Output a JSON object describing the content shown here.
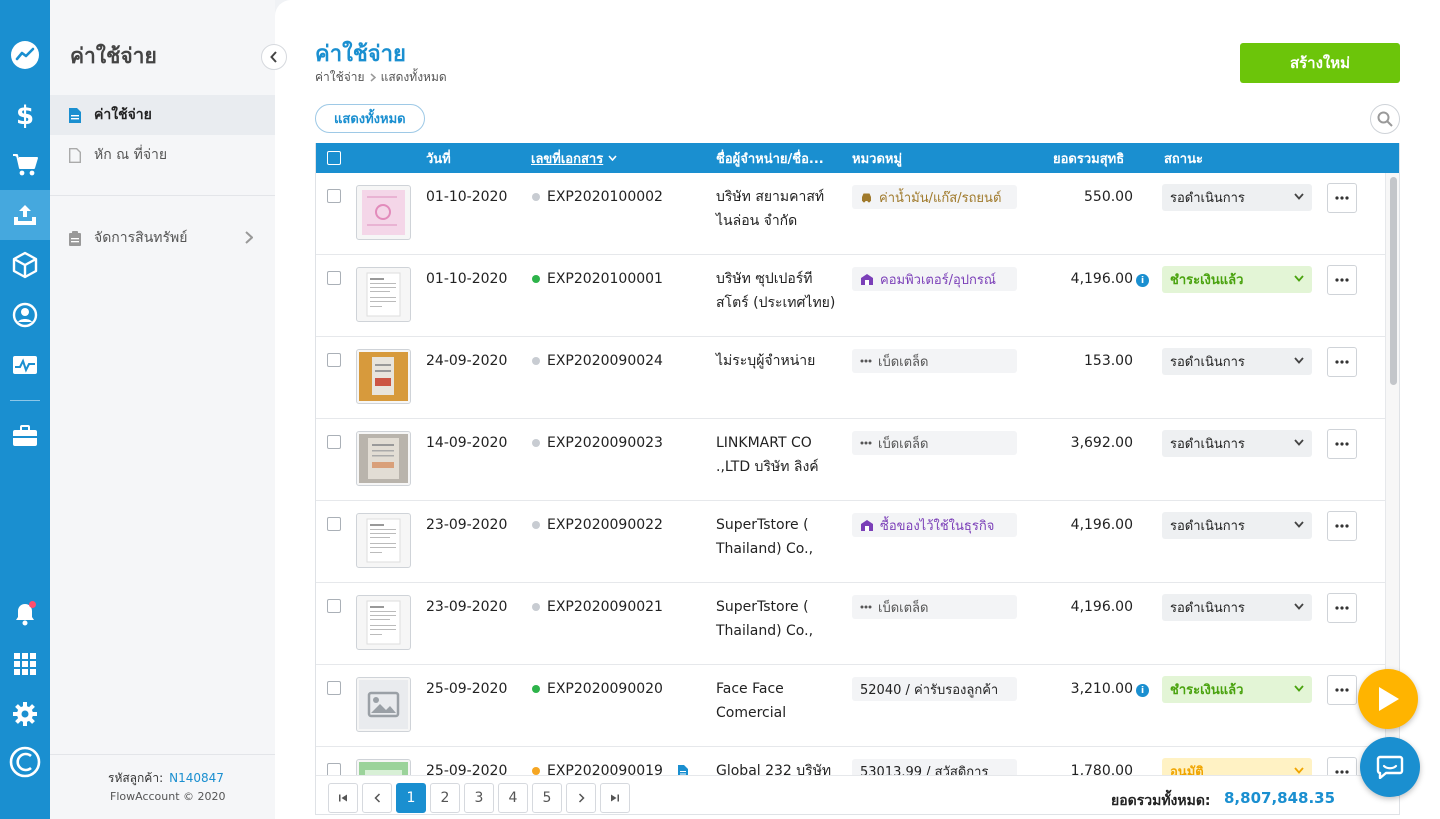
{
  "rail": {
    "items": [
      "dashboard-icon",
      "dollar-icon",
      "cart-icon",
      "expense-icon",
      "box-icon",
      "contact-icon",
      "report-icon",
      "briefcase-icon",
      "bell-icon",
      "apps-icon",
      "gear-icon",
      "flowaccount-logo-icon"
    ]
  },
  "sidebar": {
    "title": "ค่าใช้จ่าย",
    "items": [
      {
        "label": "ค่าใช้จ่าย"
      },
      {
        "label": "หัก ณ ที่จ่าย"
      },
      {
        "label": "จัดการสินทรัพย์"
      }
    ],
    "customer_label": "รหัสลูกค้า:",
    "customer_id": "N140847",
    "copyright": "FlowAccount © 2020"
  },
  "header": {
    "title": "ค่าใช้จ่าย",
    "breadcrumb": [
      "ค่าใช้จ่าย",
      "แสดงทั้งหมด"
    ],
    "create_label": "สร้างใหม่",
    "filter_label": "แสดงทั้งหมด"
  },
  "table": {
    "columns": {
      "date": "วันที่",
      "doc_no": "เลขที่เอกสาร",
      "vendor": "ชื่อผู้จำหน่าย/ชื่อ...",
      "category": "หมวดหมู่",
      "amount": "ยอดรวมสุทธิ",
      "status": "สถานะ"
    },
    "rows": [
      {
        "date": "01-10-2020",
        "doc_no": "EXP2020100002",
        "dot_color": "#c8ccd2",
        "vendor1": "บริษัท สยามคาสท์",
        "vendor2": "ไนล่อน จำกัด",
        "cat_icon": "car-icon",
        "category": "ค่าน้ำมัน/แก๊ส/รถยนต์",
        "cat_color": "#a07a2c",
        "amount": "550.00",
        "info": false,
        "status": "รอดำเนินการ",
        "status_type": "pending",
        "thumb": "pink-receipt"
      },
      {
        "date": "01-10-2020",
        "doc_no": "EXP2020100001",
        "dot_color": "#2db34a",
        "vendor1": "บริษัท ซุปเปอร์ที",
        "vendor2": "สโตร์ (ประเทศไทย)",
        "cat_icon": "shop-icon",
        "category": "คอมพิวเตอร์/อุปกรณ์",
        "cat_color": "#7b3fb8",
        "amount": "4,196.00",
        "info": true,
        "status": "ชำระเงินแล้ว",
        "status_type": "paid",
        "thumb": "invoice"
      },
      {
        "date": "24-09-2020",
        "doc_no": "EXP2020090024",
        "dot_color": "#c8ccd2",
        "vendor1": "ไม่ระบุผู้จำหน่าย",
        "vendor2": "",
        "cat_icon": "dots-icon",
        "category": "เบ็ดเตล็ด",
        "cat_color": "#555555",
        "amount": "153.00",
        "info": false,
        "status": "รอดำเนินการ",
        "status_type": "pending",
        "thumb": "photo-receipt"
      },
      {
        "date": "14-09-2020",
        "doc_no": "EXP2020090023",
        "dot_color": "#c8ccd2",
        "vendor1": "LINKMART CO",
        "vendor2": ".,LTD บริษัท ลิงค์",
        "cat_icon": "dots-icon",
        "category": "เบ็ดเตล็ด",
        "cat_color": "#555555",
        "amount": "3,692.00",
        "info": false,
        "status": "รอดำเนินการ",
        "status_type": "pending",
        "thumb": "gray-receipt"
      },
      {
        "date": "23-09-2020",
        "doc_no": "EXP2020090022",
        "dot_color": "#c8ccd2",
        "vendor1": "SuperTstore (",
        "vendor2": "Thailand) Co.,",
        "cat_icon": "shop-icon",
        "category": "ซื้อของไว้ใช้ในธุรกิจ",
        "cat_color": "#7b3fb8",
        "amount": "4,196.00",
        "info": false,
        "status": "รอดำเนินการ",
        "status_type": "pending",
        "thumb": "invoice"
      },
      {
        "date": "23-09-2020",
        "doc_no": "EXP2020090021",
        "dot_color": "#c8ccd2",
        "vendor1": "SuperTstore (",
        "vendor2": "Thailand) Co.,",
        "cat_icon": "dots-icon",
        "category": "เบ็ดเตล็ด",
        "cat_color": "#555555",
        "amount": "4,196.00",
        "info": false,
        "status": "รอดำเนินการ",
        "status_type": "pending",
        "thumb": "invoice"
      },
      {
        "date": "25-09-2020",
        "doc_no": "EXP2020090020",
        "dot_color": "#2db34a",
        "vendor1": "Face Face",
        "vendor2": "Comercial",
        "cat_icon": "",
        "category": "52040 / ค่ารับรองลูกค้า",
        "cat_color": "#222222",
        "amount": "3,210.00",
        "info": true,
        "status": "ชำระเงินแล้ว",
        "status_type": "paid",
        "thumb": "placeholder"
      },
      {
        "date": "25-09-2020",
        "doc_no": "EXP2020090019",
        "dot_color": "#f5a623",
        "vendor1": "Global 232 บริษัท",
        "vendor2": "",
        "cat_icon": "",
        "category": "53013.99 / สวัสดิการ",
        "cat_color": "#222222",
        "amount": "1,780.00",
        "info": false,
        "status": "อนุมัติ",
        "status_type": "approve",
        "thumb": "green-receipt"
      }
    ]
  },
  "pagination": {
    "pages": [
      "1",
      "2",
      "3",
      "4",
      "5"
    ],
    "active": "1"
  },
  "totals": {
    "label": "ยอดรวมทั้งหมด:",
    "value": "8,807,848.35"
  },
  "colors": {
    "primary": "#1a8fd0",
    "create": "#6cc50a",
    "paid": "#4aa30f",
    "approve": "#f0a500",
    "fab": "#ffb400"
  }
}
